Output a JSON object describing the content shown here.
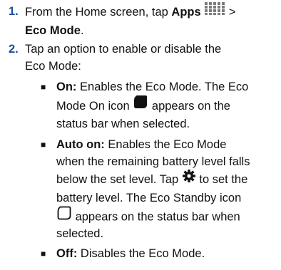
{
  "steps": [
    {
      "number": "1.",
      "line1_pre": "From the Home screen, tap ",
      "line1_bold": "Apps",
      "line1_post": " >",
      "line2_bold": "Eco Mode",
      "line2_post": ".",
      "icon": "apps-grid-icon"
    },
    {
      "number": "2.",
      "line1": "Tap an option to enable or disable the",
      "line2": "Eco Mode:"
    }
  ],
  "options": [
    {
      "label": "On:",
      "lines": [
        " Enables the Eco Mode. The Eco",
        "Mode On icon ",
        " appears on the",
        "status bar when selected."
      ],
      "icon": "eco-mode-on-icon"
    },
    {
      "label": "Auto on:",
      "lines": [
        " Enables the Eco Mode",
        "when the remaining battery level falls",
        "below the set level. Tap ",
        " to set the",
        "battery level. The Eco Standby icon",
        " appears on the status bar when",
        "selected."
      ],
      "icons": [
        "settings-gear-icon",
        "eco-standby-icon"
      ]
    },
    {
      "label": "Off:",
      "lines": [
        " Disables the Eco Mode."
      ]
    }
  ],
  "colors": {
    "step_number": "#1a4f9c",
    "text": "#111111"
  }
}
